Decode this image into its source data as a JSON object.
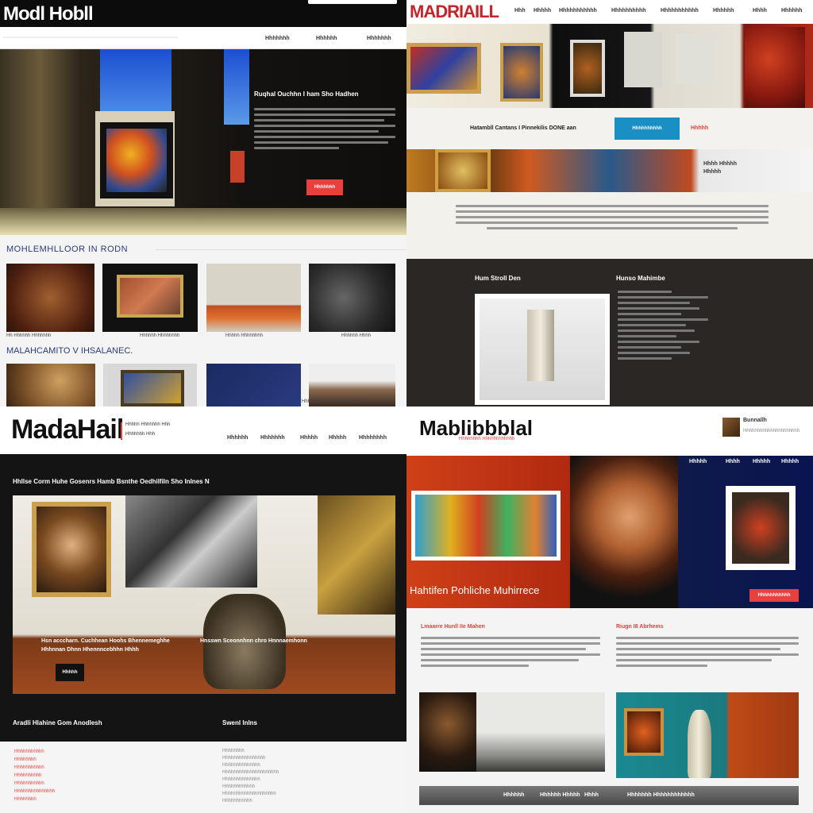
{
  "q1": {
    "logo": "Modl Hobll",
    "nav": [
      "Hhhhhhh",
      "Hhhhhh",
      "Hhhhhhh"
    ],
    "hero": {
      "title": "Ruqhal Ouchhn I ham Sho Hadhen",
      "button": "Hhhhhhh"
    },
    "section_title": "MOHLEMHLLOOR IN RODN",
    "row1_captions": [
      "Hh Hhhhhh Hhhhhhh",
      "Hhhhhh Hhhhhhhh",
      "Hhhhh Hhhhhhhh",
      "Hhhhhh Hhhh"
    ],
    "section2_title": "MALAHCAMITO V IHSALANEC.",
    "row2_caption": "Hhhhhhhh Hhhhhh Hhhhhhhh"
  },
  "q2": {
    "logo": "MADRIAILL",
    "nav": [
      "Hhh",
      "Hhhhh",
      "Hhhhhhhhhhh",
      "Hhhhhhhhhh",
      "Hhhhhhhhhhh",
      "Hhhhhh",
      "Hhhh",
      "Hhhhhh"
    ],
    "cta_text": "Hatambll Cantans I Pinnekilis DONE aan",
    "cta_button": "Hhhhhhhhhh",
    "cta_link": "Hhhhh",
    "side_label": "Hhhh Hhhhh Hhhhh",
    "feature_left_title": "Hum Stroll Den",
    "feature_right_title": "Hunso Mahimbe"
  },
  "q3": {
    "logo": "MadaHail",
    "tagline": [
      "Hhhhh Hhhhhhh Hhh",
      "Hhhhhhh Hhh"
    ],
    "nav": [
      "Hhhhhh",
      "Hhhhhhh",
      "Hhhhh",
      "Hhhhh",
      "Hhhhhhhh"
    ],
    "headline": "Hhllse Corm Huhe Gosenrs Hamb Bsnthe Oedhilfiln Sho Inlnes N",
    "overlay_left": [
      "Hsn acccharn. Cuchhean Hoohs Bhennemeghhe",
      "Hhhnnan Dhnn Hhennncebhhn Hhhh"
    ],
    "overlay_right": "Hnsswn Sceonnhnn chro Hnnnaemhonn",
    "button": "Hhhhh",
    "footer_left_title": "Aradli Hlahine Gom Anodlesh",
    "footer_right_title": "Swenl Inlns",
    "footer_left_links": [
      "Hhhhhhhhhhh",
      "Hhhhhhhh",
      "Hhhhhhhhhhh",
      "Hhhhhhhhhh",
      "Hhhhhhhhhhh",
      "Hhhhhhhhhhhhhhh",
      "Hhhhhhhh"
    ],
    "footer_right_links": [
      "Hhhhhhhh",
      "Hhhhhhhhhhhhhhhh",
      "Hhhhhhhhhhhhhh",
      "Hhhhhhhhhhhhhhhhhhhhh",
      "Hhhhhhhhhhhhhh",
      "Hhhhhhhhhhhh",
      "Hhhhhhhhhhhhhhhhhhhh",
      "Hhhhhhhhhhh"
    ]
  },
  "q4": {
    "logo": "Mablibbblal",
    "sub": "Hhhhhhhh Hhhhhhhhhhhh",
    "profile_name": "Bunnallh",
    "profile_sub": "Hhhhhhhhhhhhhhhhhhhhh",
    "nav": [
      "Hhhhh",
      "Hhhh",
      "Hhhhh",
      "Hhhhh"
    ],
    "hero_title": "Hahtifen Pohliche Muhirrece",
    "hero_button": "Hhhhhhhhhhh",
    "col1_title": "Lmaarre Hunll IIe Mahen",
    "col2_title": "Riugn I8 Abrhems",
    "footer_links": [
      "Hhhhhh",
      "Hhhhhh Hhhhh",
      "Hhhh",
      "Hhhhhhh Hhhhhhhhhhhh"
    ]
  },
  "colors": {
    "accent_red": "#e8413d",
    "accent_blue": "#1a8fc4",
    "dark_bg": "#141414"
  }
}
